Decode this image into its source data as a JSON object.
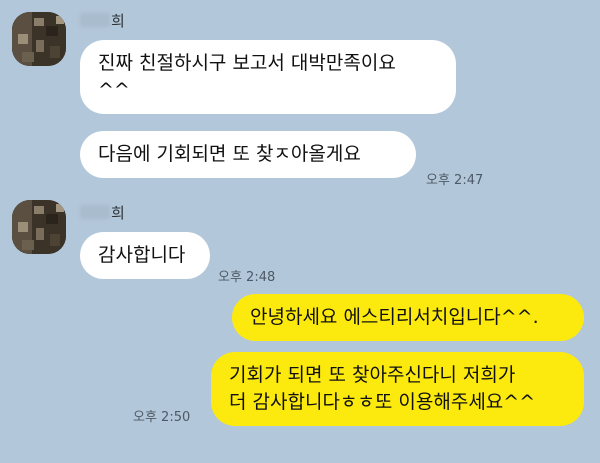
{
  "messages": [
    {
      "sender_name": "희",
      "bubbles": [
        "진짜 친절하시구 보고서 대박만족이요\n^^",
        "다음에 기회되면 또 찾ㅈ아올게요"
      ],
      "time": "오후 2:47"
    },
    {
      "sender_name": "희",
      "bubbles": [
        "감사합니다"
      ],
      "time": "오후 2:48"
    },
    {
      "sender_name": "",
      "bubbles": [
        "안녕하세요 에스티리서치입니다^^.",
        "기회가 되면 또 찾아주신다니 저희가\n더 감사합니다ㅎㅎ또 이용해주세요^^"
      ],
      "time": "오후 2:50"
    }
  ],
  "colors": {
    "background": "#b2c7d9",
    "incoming_bubble": "#ffffff",
    "outgoing_bubble": "#fcea0e"
  },
  "icons": {
    "avatar": "profile-photo"
  }
}
